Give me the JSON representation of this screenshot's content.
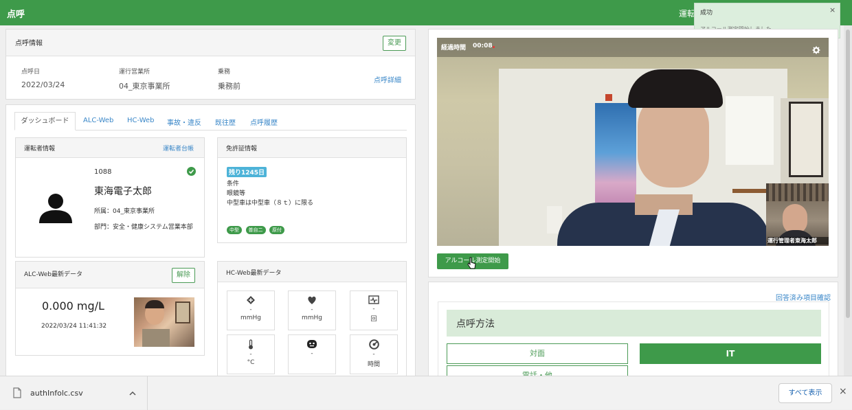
{
  "header": {
    "title": "点呼",
    "right_text": "運転"
  },
  "toast": {
    "title": "成功",
    "message": "アルコール測定開始しました",
    "close": "×"
  },
  "rollcall_info": {
    "title": "点呼情報",
    "change_button": "変更",
    "fields": [
      {
        "label": "点呼日",
        "value": "2022/03/24"
      },
      {
        "label": "運行営業所",
        "value": "04_東京事業所"
      },
      {
        "label": "乗務",
        "value": "乗務前"
      }
    ],
    "detail_link": "点呼詳細"
  },
  "tabs": [
    "ダッシュボード",
    "ALC-Web",
    "HC-Web",
    "事故・違反",
    "既往歴",
    "点呼履歴"
  ],
  "driver": {
    "title": "運転者情報",
    "ledger_link": "運転者台帳",
    "id": "1088",
    "name": "東海電子太郎",
    "affiliation": "所属：04_東京事業所",
    "department": "部門：安全・健康システム営業本部"
  },
  "license": {
    "title": "免許証情報",
    "remaining": "残り1245日",
    "condition_label": "条件",
    "condition1": "眼鏡等",
    "condition2": "中型車は中型車（８ｔ）に限る",
    "badges": [
      "中型",
      "普自二",
      "原付"
    ]
  },
  "alc": {
    "title": "ALC-Web最新データ",
    "button": "解除",
    "value": "0.000 mg/L",
    "datetime": "2022/03/24 11:41:32"
  },
  "hc": {
    "title": "HC-Web最新データ",
    "cells": [
      {
        "icon": "blood-pressure-high-icon",
        "value": "-",
        "unit": "mmHg"
      },
      {
        "icon": "blood-pressure-low-icon",
        "value": "-",
        "unit": "mmHg"
      },
      {
        "icon": "heart-rate-icon",
        "value": "-",
        "unit": "回"
      },
      {
        "icon": "thermometer-icon",
        "value": "-",
        "unit": "°C"
      },
      {
        "icon": "face-icon",
        "value": "-",
        "unit": ""
      },
      {
        "icon": "sleep-icon",
        "value": "-",
        "unit": "時間"
      }
    ]
  },
  "video": {
    "elapsed_label": "経過時間",
    "elapsed_time": "00:08",
    "pip_caption": "運行管理者東海太郎"
  },
  "alcohol_button": "アルコール測定開始",
  "method": {
    "confirm_link": "回答済み項目確認",
    "title": "点呼方法",
    "options": [
      "対面",
      "IT",
      "電話・他"
    ]
  },
  "download": {
    "file_name": "authInfolc.csv",
    "show_all": "すべて表示",
    "close": "×"
  },
  "colors": {
    "primary": "#3e9a4a",
    "link": "#3a87c8",
    "badge": "#4db3d8"
  }
}
